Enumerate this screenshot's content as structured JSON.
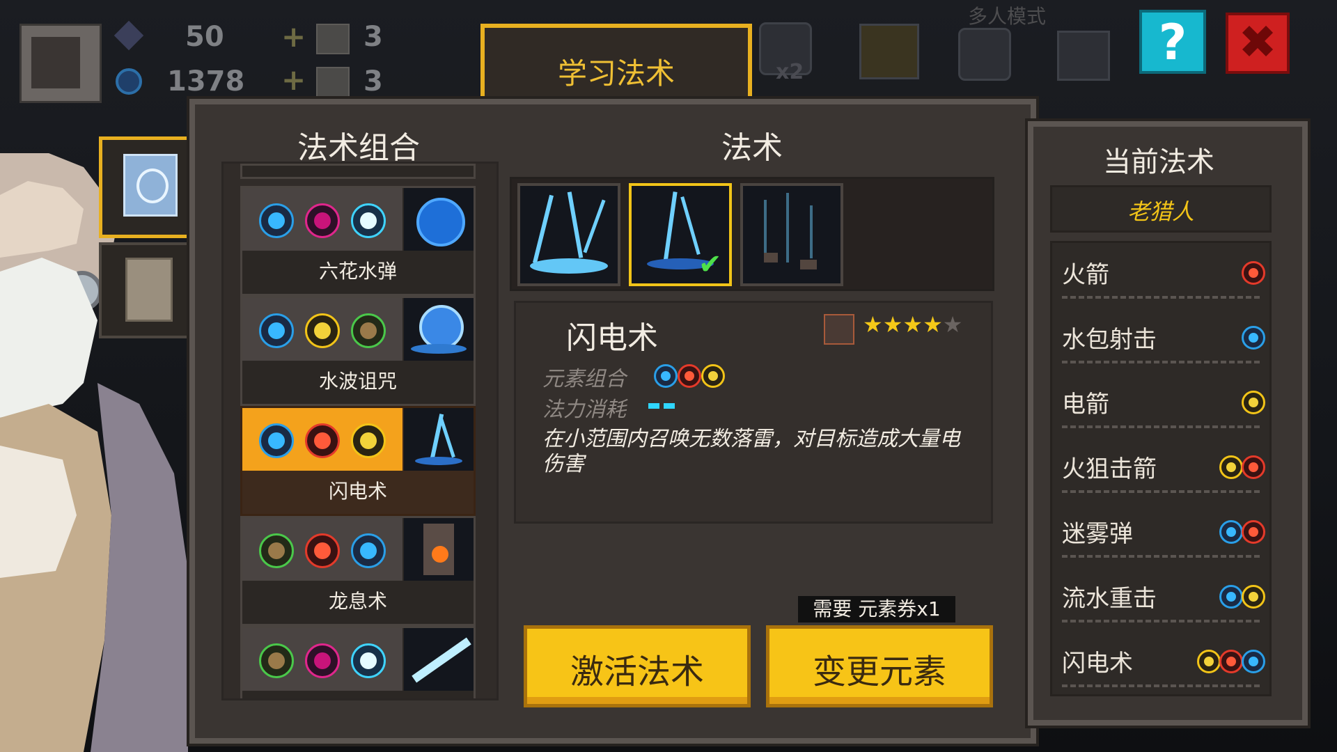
{
  "hud": {
    "gems": "50",
    "crystals": "1378",
    "item_a": "3",
    "item_b": "3",
    "mode_label": "多人模式",
    "multiplier": "x2",
    "help": "?",
    "close": "✖"
  },
  "main": {
    "title": "学习法术",
    "combos_header": "法术组合",
    "spell_header": "法术",
    "combos": [
      {
        "name": "六花水弹",
        "elements": [
          "water",
          "magic",
          "ice"
        ]
      },
      {
        "name": "水波诅咒",
        "elements": [
          "water",
          "electric",
          "earth"
        ]
      },
      {
        "name": "闪电术",
        "elements": [
          "water",
          "fire",
          "electric"
        ],
        "selected": true
      },
      {
        "name": "龙息术",
        "elements": [
          "earth",
          "fire",
          "water"
        ]
      },
      {
        "name": "",
        "elements": [
          "earth",
          "magic",
          "ice"
        ]
      }
    ],
    "detail": {
      "name": "闪电术",
      "element_label": "元素组合",
      "mana_label": "法力消耗",
      "rating": 4,
      "rating_max": 5,
      "description": "在小范围内召唤无数落雷，对目标造成大量电伤害"
    },
    "activate_label": "激活法术",
    "change_label": "变更元素",
    "need_tip": "需要 元素券x1"
  },
  "right": {
    "header": "当前法术",
    "owner": "老猎人",
    "spells": [
      {
        "name": "火箭",
        "elements": [
          "fire"
        ]
      },
      {
        "name": "水包射击",
        "elements": [
          "water"
        ]
      },
      {
        "name": "电箭",
        "elements": [
          "electric"
        ]
      },
      {
        "name": "火狙击箭",
        "elements": [
          "electric",
          "fire"
        ]
      },
      {
        "name": "迷雾弹",
        "elements": [
          "water",
          "fire"
        ]
      },
      {
        "name": "流水重击",
        "elements": [
          "water",
          "electric"
        ]
      },
      {
        "name": "闪电术",
        "elements": [
          "electric",
          "fire",
          "water"
        ]
      }
    ]
  },
  "colors": {
    "accent": "#f2c418",
    "panel": "#3a3532",
    "selected_combo": "#f4a21c",
    "button": "#f7c417"
  }
}
